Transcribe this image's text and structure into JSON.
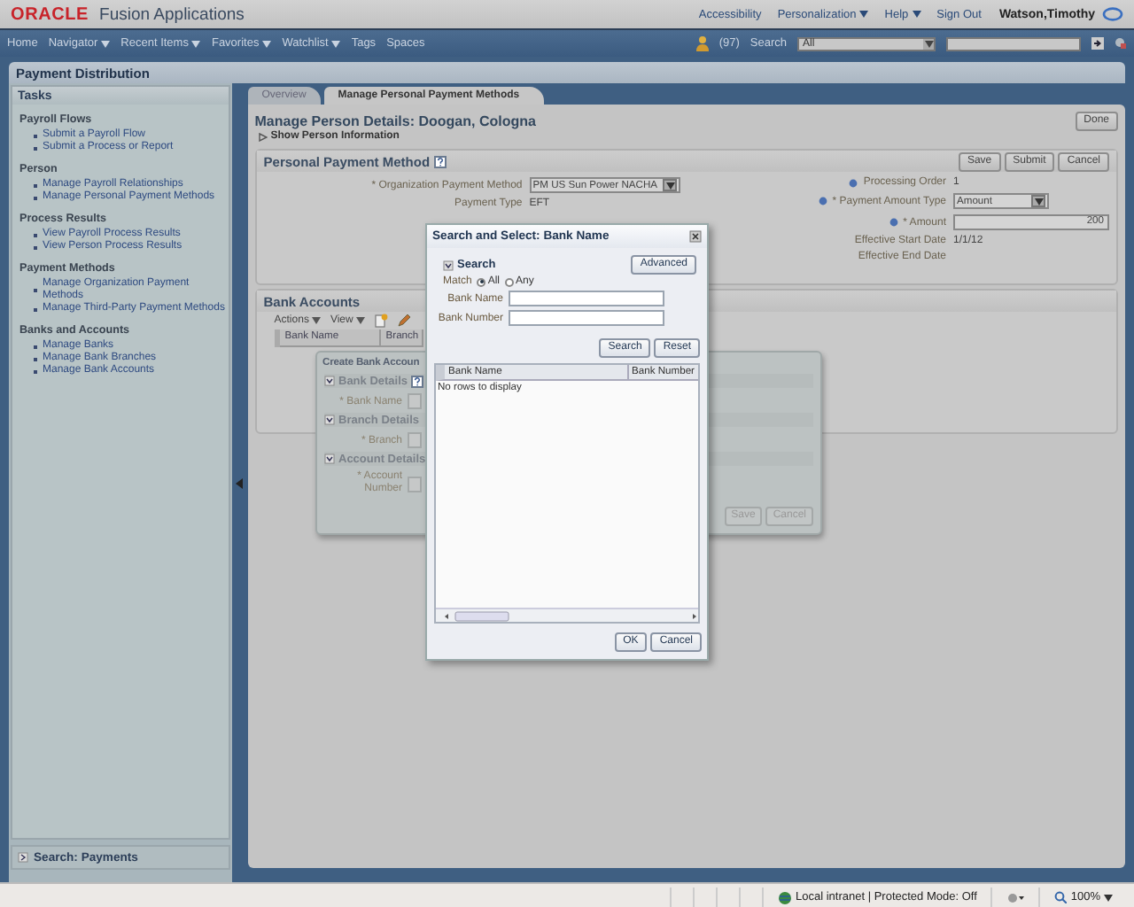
{
  "header": {
    "logo": "ORACLE",
    "product": "Fusion Applications",
    "links": [
      {
        "label": "Accessibility",
        "menu": false
      },
      {
        "label": "Personalization",
        "menu": true
      },
      {
        "label": "Help",
        "menu": true
      },
      {
        "label": "Sign Out",
        "menu": false
      }
    ],
    "user": "Watson,Timothy"
  },
  "nav": {
    "items": [
      {
        "label": "Home",
        "menu": false
      },
      {
        "label": "Navigator",
        "menu": true
      },
      {
        "label": "Recent Items",
        "menu": true
      },
      {
        "label": "Favorites",
        "menu": true
      },
      {
        "label": "Watchlist",
        "menu": true
      },
      {
        "label": "Tags",
        "menu": false
      },
      {
        "label": "Spaces",
        "menu": false
      }
    ],
    "notifications": "(97)",
    "search_label": "Search",
    "search_scope": "All"
  },
  "area_title": "Payment Distribution",
  "tasks": {
    "title": "Tasks",
    "groups": [
      {
        "title": "Payroll Flows",
        "items": [
          "Submit a Payroll Flow",
          "Submit a Process or Report"
        ]
      },
      {
        "title": "Person",
        "items": [
          "Manage Payroll Relationships",
          "Manage Personal Payment Methods"
        ]
      },
      {
        "title": "Process Results",
        "items": [
          "View Payroll Process Results",
          "View Person Process Results"
        ]
      },
      {
        "title": "Payment Methods",
        "items": [
          "Manage Organization Payment Methods",
          "Manage Third-Party Payment Methods"
        ]
      },
      {
        "title": "Banks and Accounts",
        "items": [
          "Manage Banks",
          "Manage Bank Branches",
          "Manage Bank Accounts"
        ]
      }
    ]
  },
  "search_panel": "Search: Payments",
  "tabs": [
    {
      "label": "Overview",
      "selected": false
    },
    {
      "label": "Manage Personal Payment Methods",
      "selected": true
    }
  ],
  "page": {
    "title": "Manage Person Details: Doogan, Cologna",
    "show_info": "Show Person Information",
    "done": "Done"
  },
  "payment_method": {
    "title": "Personal Payment Method",
    "buttons": [
      "Save",
      "Submit",
      "Cancel"
    ],
    "left_fields": [
      {
        "label": "* Organization Payment Method",
        "value": "PM US Sun Power NACHA",
        "kind": "select"
      },
      {
        "label": "Payment Type",
        "value": "EFT",
        "kind": "text"
      }
    ],
    "right_fields": [
      {
        "label": "Processing Order",
        "value": "1",
        "kind": "text",
        "help": true
      },
      {
        "label": "* Payment Amount Type",
        "value": "Amount",
        "kind": "select",
        "help": true
      },
      {
        "label": "* Amount",
        "value": "200",
        "kind": "input",
        "help": true
      },
      {
        "label": "Effective Start Date",
        "value": "1/1/12",
        "kind": "text",
        "help": false
      },
      {
        "label": "Effective End Date",
        "kind": "text",
        "help": false
      }
    ]
  },
  "bank_accounts": {
    "title": "Bank Accounts",
    "toolbar": [
      {
        "label": "Actions",
        "menu": true
      },
      {
        "label": "View",
        "menu": true
      }
    ],
    "columns": [
      "Bank Name",
      "Branch"
    ]
  },
  "create_dialog": {
    "title": "Create Bank Accoun",
    "sections": [
      {
        "title": "Bank Details",
        "help": true,
        "field": "* Bank Name"
      },
      {
        "title": "Branch Details",
        "help": false,
        "field": "* Branch"
      },
      {
        "title": "Account Details",
        "help": false,
        "field": "* Account Number"
      }
    ],
    "buttons": [
      "Save",
      "Cancel"
    ]
  },
  "search_dialog": {
    "title": "Search and Select: Bank Name",
    "section": "Search",
    "advanced": "Advanced",
    "match_label": "Match",
    "match": [
      {
        "label": "All",
        "selected": true
      },
      {
        "label": "Any",
        "selected": false
      }
    ],
    "fields": [
      {
        "label": "Bank Name"
      },
      {
        "label": "Bank Number"
      }
    ],
    "buttons": [
      "Search",
      "Reset"
    ],
    "columns": [
      "Bank Name",
      "Bank Number"
    ],
    "empty": "No rows to display",
    "footer": [
      "OK",
      "Cancel"
    ]
  },
  "status_bar": {
    "zone": "Local intranet | Protected Mode: Off",
    "zoom": "100%"
  }
}
